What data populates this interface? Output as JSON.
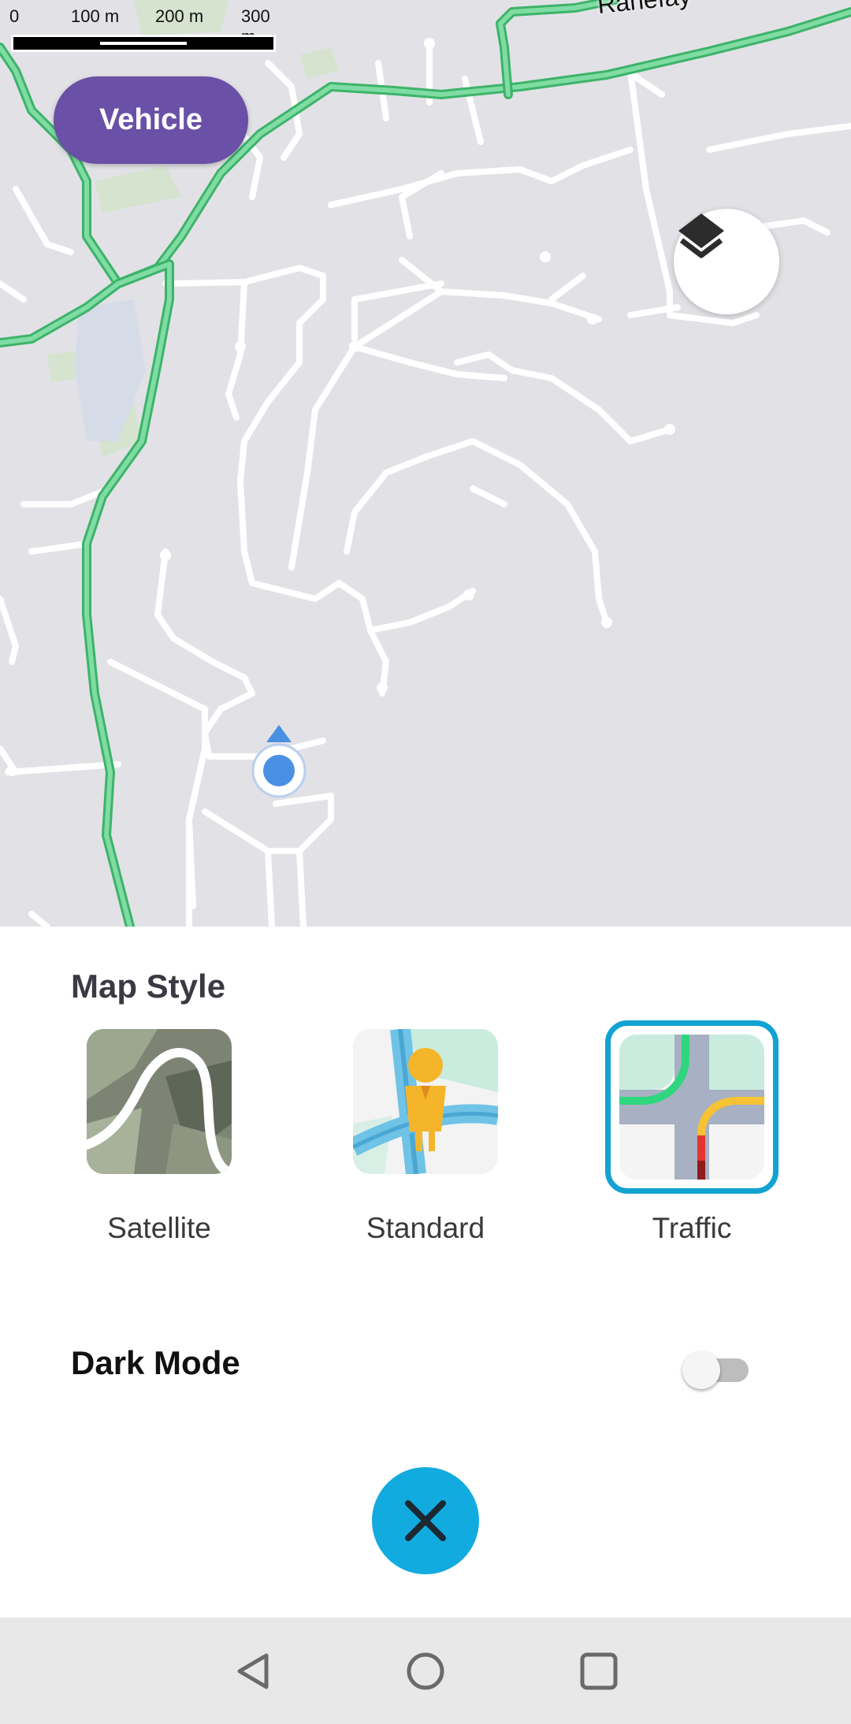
{
  "map": {
    "scale_labels": [
      "0",
      "100 m",
      "200 m",
      "300 m"
    ],
    "street_label": "Ranefay",
    "colors": {
      "background": "#e2e2e6",
      "road": "#ffffff",
      "highway": "#5cc98a",
      "location": "#4a90e2"
    }
  },
  "vehicle_button": {
    "label": "Vehicle",
    "color": "#6a50a7"
  },
  "layers_button": {
    "icon": "layers-icon"
  },
  "sheet": {
    "title": "Map Style",
    "styles": [
      {
        "label": "Satellite",
        "selected": false
      },
      {
        "label": "Standard",
        "selected": false
      },
      {
        "label": "Traffic",
        "selected": true
      }
    ],
    "dark_mode": {
      "label": "Dark Mode",
      "enabled": false
    },
    "close_icon": "close-icon",
    "accent": "#12abdf"
  },
  "navbar": {
    "items": [
      "back-icon",
      "home-icon",
      "recents-icon"
    ]
  }
}
